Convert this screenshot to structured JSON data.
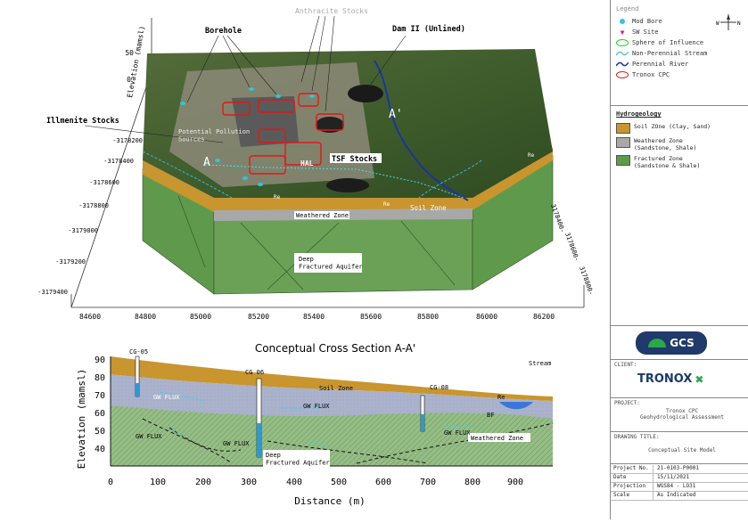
{
  "block": {
    "title": "Anthracite Stocks",
    "elev_axis_label": "Elevation (mamsl)",
    "elev_ticks": [
      "50",
      "0"
    ],
    "y_ticks": [
      "-3178200",
      "-3178400",
      "-3178600",
      "-3178800",
      "-3179000",
      "-3179200",
      "-3179400"
    ],
    "x_ticks": [
      "84600",
      "84800",
      "85000",
      "85200",
      "85400",
      "85600",
      "85800",
      "86000",
      "86200"
    ],
    "right_ticks": [
      "3178400-",
      "3178600-",
      "3178800-"
    ],
    "labels": {
      "borehole": "Borehole",
      "dam": "Dam II (Unlined)",
      "illmenite": "Illmenite Stocks",
      "pollution": "Potential Pollution\nSources",
      "a_left": "A",
      "a_right": "A'",
      "hal": "HAL",
      "tsf": "TSF Stocks",
      "soil": "Soil Zone",
      "weathered": "Weathered Zone",
      "deep": "Deep\nFractured Aquifer",
      "re1": "Re",
      "re2": "Re",
      "re3": "Re"
    }
  },
  "section": {
    "title": "Conceptual Cross Section A-A'",
    "xlabel": "Distance (m)",
    "ylabel": "Elevation (mamsl)",
    "x_ticks": [
      "0",
      "100",
      "200",
      "300",
      "400",
      "500",
      "600",
      "700",
      "800",
      "900"
    ],
    "y_ticks": [
      "90",
      "80",
      "70",
      "60",
      "50",
      "40"
    ],
    "boreholes": [
      "CG-05",
      "CG 06",
      "CG-08"
    ],
    "labels": {
      "stream": "Stream",
      "soil": "Soil Zone",
      "weathered": "Weathered Zone",
      "deep": "Deep\nFractured Aquifer",
      "bf": "BF",
      "re": "Re",
      "gw1": "GW FLUX",
      "gw2": "GW FLUX",
      "gw3": "GW FLUX",
      "gw4": "GW FLUX",
      "gw5": "GW FLUX"
    }
  },
  "legend": {
    "title": "Legend",
    "compass": "N",
    "items": [
      {
        "label": "Mod Bore",
        "color": "#28c8e0"
      },
      {
        "label": "SW Site",
        "color": "#d0208a"
      },
      {
        "label": "Sphere of Influence",
        "color": "#22cc22"
      },
      {
        "label": "Non-Perennial Stream",
        "color": "#40b8d8"
      },
      {
        "label": "Perennial River",
        "color": "#1a2fb0"
      },
      {
        "label": "Tronox CPC",
        "color": "#d81818"
      }
    ],
    "hydro_title": "Hydrogeology",
    "hydro": [
      {
        "label": "Soil ZOne (Clay, Sand)",
        "color": "#c8952e"
      },
      {
        "label": "Weathered Zone\n(Sandstone, Shale)",
        "color": "#a8a8a8"
      },
      {
        "label": "Fractured Zone\n(Sandstone & Shale)",
        "color": "#5c9a4c"
      }
    ]
  },
  "title_block": {
    "logo": "GCS",
    "client_label": "CLIENT:",
    "client": "TRONOX",
    "project_label": "PROJECT:",
    "project": "Tronox CPC\nGeohydrological Assessment",
    "drawing_label": "DRAWING TITLE:",
    "drawing": "Conceptual Site Model",
    "rows": [
      {
        "k": "Project No.",
        "v": "21-0103-P0001"
      },
      {
        "k": "Date",
        "v": "15/11/2021"
      },
      {
        "k": "Projection",
        "v": "WGS84 - LO31"
      },
      {
        "k": "Scale",
        "v": "As Indicated"
      }
    ]
  }
}
